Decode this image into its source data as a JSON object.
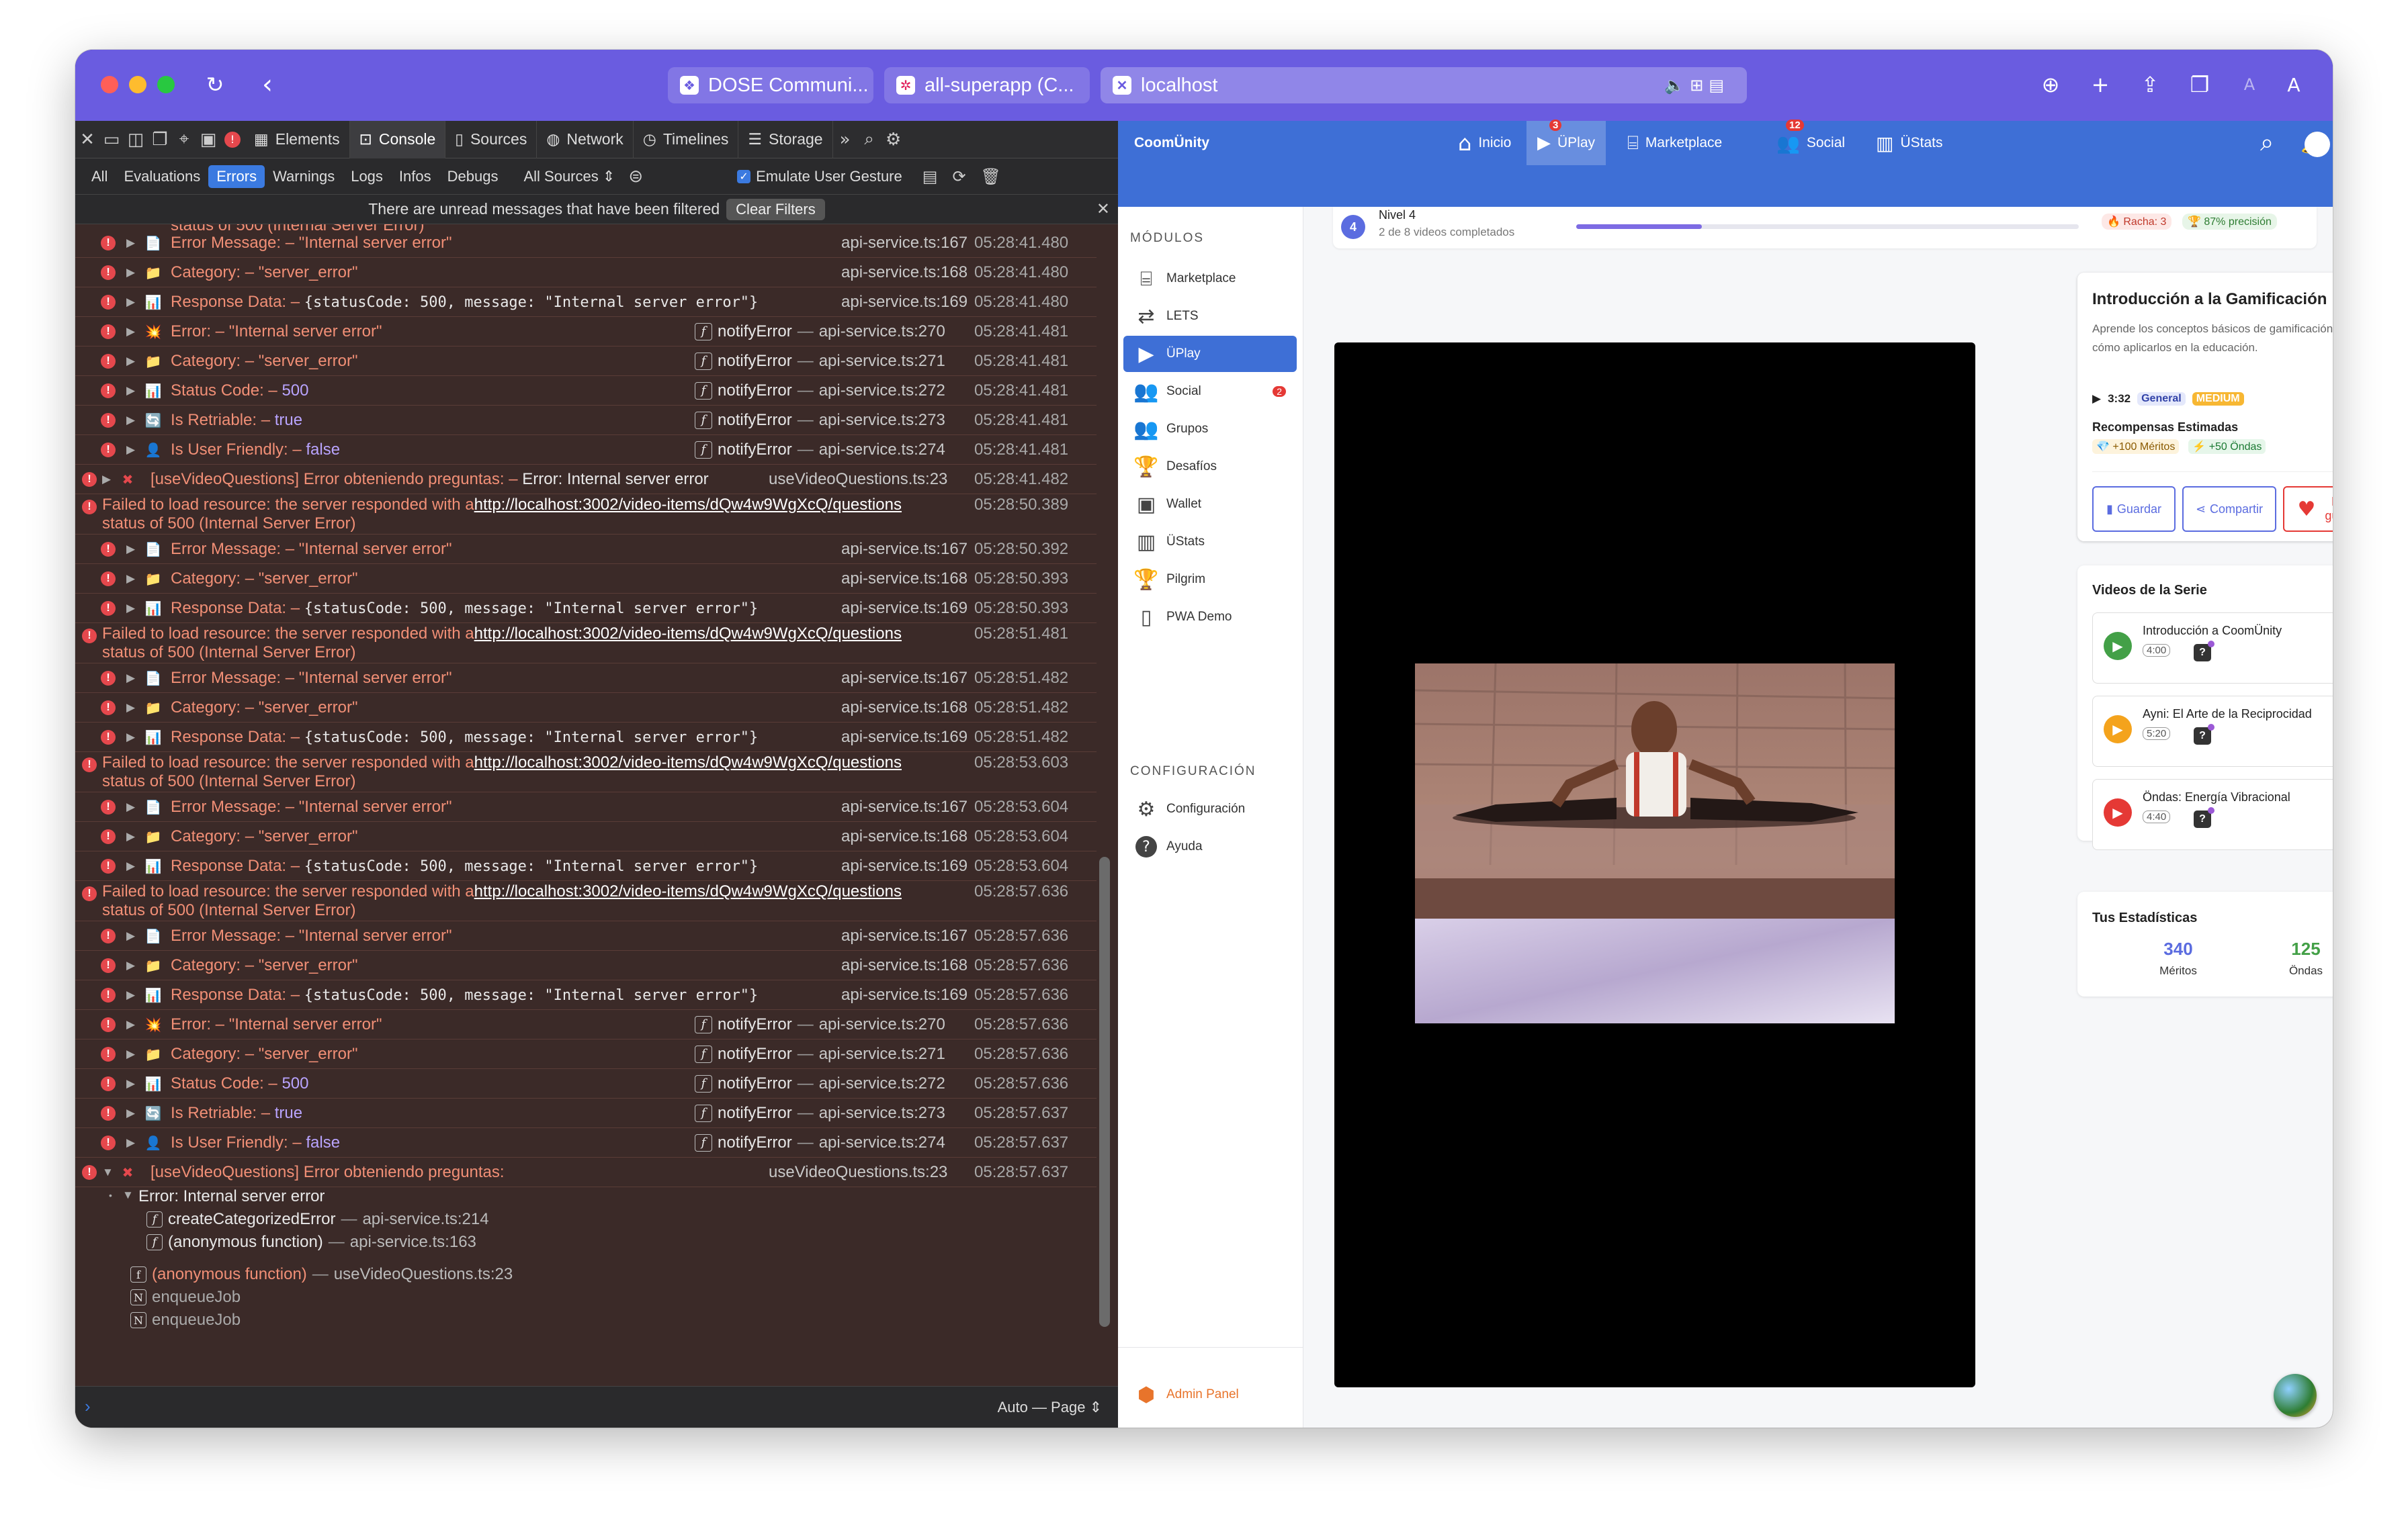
{
  "browser": {
    "tabs": [
      {
        "label": "DOSE Communi..."
      },
      {
        "label": "all-superapp (C..."
      },
      {
        "label": "localhost"
      }
    ],
    "profile_letters": [
      "A",
      "A"
    ]
  },
  "devtools": {
    "tabs": [
      "Elements",
      "Console",
      "Sources",
      "Network",
      "Timelines",
      "Storage"
    ],
    "filters": [
      "All",
      "Evaluations",
      "Errors",
      "Warnings",
      "Logs",
      "Infos",
      "Debugs",
      "All Sources"
    ],
    "emulate_label": "Emulate User Gesture",
    "banner": "There are unread messages that have been filtered",
    "clear_filters": "Clear Filters",
    "bottom_mode": "Auto — Page",
    "truncated_top": "status of 500 (Internal Server Error)",
    "rows": [
      {
        "type": "sub",
        "icon": "page",
        "label": "Error Message:",
        "value": "\"Internal server error\"",
        "src": "api-service.ts:167",
        "time": "05:28:41.480"
      },
      {
        "type": "sub",
        "icon": "folder",
        "label": "Category:",
        "value": "\"server_error\"",
        "src": "api-service.ts:168",
        "time": "05:28:41.480"
      },
      {
        "type": "resp",
        "icon": "chart",
        "label": "Response Data:",
        "value": "{statusCode: 500, message: \"Internal server error\"}",
        "src": "api-service.ts:169",
        "time": "05:28:41.480"
      },
      {
        "type": "fn",
        "icon": "boom",
        "label": "Error:",
        "value": "\"Internal server error\"",
        "fn": "notifyError",
        "src": "api-service.ts:270",
        "time": "05:28:41.481"
      },
      {
        "type": "fn",
        "icon": "folder",
        "label": "Category:",
        "value": "\"server_error\"",
        "fn": "notifyError",
        "src": "api-service.ts:271",
        "time": "05:28:41.481"
      },
      {
        "type": "fn",
        "icon": "chart",
        "label": "Status Code:",
        "value": "500",
        "fn": "notifyError",
        "src": "api-service.ts:272",
        "time": "05:28:41.481"
      },
      {
        "type": "fn",
        "icon": "retry",
        "label": "Is Retriable:",
        "value": "true",
        "fn": "notifyError",
        "src": "api-service.ts:273",
        "time": "05:28:41.481"
      },
      {
        "type": "fn",
        "icon": "user",
        "label": "Is User Friendly:",
        "value": "false",
        "fn": "notifyError",
        "src": "api-service.ts:274",
        "time": "05:28:41.481"
      },
      {
        "type": "top",
        "label": "[useVideoQuestions] Error obteniendo preguntas:",
        "value": "Error: Internal server error",
        "src": "useVideoQuestions.ts:23",
        "time": "05:28:41.482"
      },
      {
        "type": "fail",
        "text": "Failed to load resource: the server responded with a",
        "url": "http://localhost:3002/video-items/dQw4w9WgXcQ/questions",
        "line2": "status of 500 (Internal Server Error)",
        "time": "05:28:50.389"
      },
      {
        "type": "sub",
        "icon": "page",
        "label": "Error Message:",
        "value": "\"Internal server error\"",
        "src": "api-service.ts:167",
        "time": "05:28:50.392"
      },
      {
        "type": "sub",
        "icon": "folder",
        "label": "Category:",
        "value": "\"server_error\"",
        "src": "api-service.ts:168",
        "time": "05:28:50.393"
      },
      {
        "type": "resp",
        "icon": "chart",
        "label": "Response Data:",
        "value": "{statusCode: 500, message: \"Internal server error\"}",
        "src": "api-service.ts:169",
        "time": "05:28:50.393"
      },
      {
        "type": "fail",
        "text": "Failed to load resource: the server responded with a",
        "url": "http://localhost:3002/video-items/dQw4w9WgXcQ/questions",
        "line2": "status of 500 (Internal Server Error)",
        "time": "05:28:51.481"
      },
      {
        "type": "sub",
        "icon": "page",
        "label": "Error Message:",
        "value": "\"Internal server error\"",
        "src": "api-service.ts:167",
        "time": "05:28:51.482"
      },
      {
        "type": "sub",
        "icon": "folder",
        "label": "Category:",
        "value": "\"server_error\"",
        "src": "api-service.ts:168",
        "time": "05:28:51.482"
      },
      {
        "type": "resp",
        "icon": "chart",
        "label": "Response Data:",
        "value": "{statusCode: 500, message: \"Internal server error\"}",
        "src": "api-service.ts:169",
        "time": "05:28:51.482"
      },
      {
        "type": "fail",
        "text": "Failed to load resource: the server responded with a",
        "url": "http://localhost:3002/video-items/dQw4w9WgXcQ/questions",
        "line2": "status of 500 (Internal Server Error)",
        "time": "05:28:53.603"
      },
      {
        "type": "sub",
        "icon": "page",
        "label": "Error Message:",
        "value": "\"Internal server error\"",
        "src": "api-service.ts:167",
        "time": "05:28:53.604"
      },
      {
        "type": "sub",
        "icon": "folder",
        "label": "Category:",
        "value": "\"server_error\"",
        "src": "api-service.ts:168",
        "time": "05:28:53.604"
      },
      {
        "type": "resp",
        "icon": "chart",
        "label": "Response Data:",
        "value": "{statusCode: 500, message: \"Internal server error\"}",
        "src": "api-service.ts:169",
        "time": "05:28:53.604"
      },
      {
        "type": "fail",
        "text": "Failed to load resource: the server responded with a",
        "url": "http://localhost:3002/video-items/dQw4w9WgXcQ/questions",
        "line2": "status of 500 (Internal Server Error)",
        "time": "05:28:57.636"
      },
      {
        "type": "sub",
        "icon": "page",
        "label": "Error Message:",
        "value": "\"Internal server error\"",
        "src": "api-service.ts:167",
        "time": "05:28:57.636"
      },
      {
        "type": "sub",
        "icon": "folder",
        "label": "Category:",
        "value": "\"server_error\"",
        "src": "api-service.ts:168",
        "time": "05:28:57.636"
      },
      {
        "type": "resp",
        "icon": "chart",
        "label": "Response Data:",
        "value": "{statusCode: 500, message: \"Internal server error\"}",
        "src": "api-service.ts:169",
        "time": "05:28:57.636"
      },
      {
        "type": "fn",
        "icon": "boom",
        "label": "Error:",
        "value": "\"Internal server error\"",
        "fn": "notifyError",
        "src": "api-service.ts:270",
        "time": "05:28:57.636"
      },
      {
        "type": "fn",
        "icon": "folder",
        "label": "Category:",
        "value": "\"server_error\"",
        "fn": "notifyError",
        "src": "api-service.ts:271",
        "time": "05:28:57.636"
      },
      {
        "type": "fn",
        "icon": "chart",
        "label": "Status Code:",
        "value": "500",
        "fn": "notifyError",
        "src": "api-service.ts:272",
        "time": "05:28:57.636"
      },
      {
        "type": "fn",
        "icon": "retry",
        "label": "Is Retriable:",
        "value": "true",
        "fn": "notifyError",
        "src": "api-service.ts:273",
        "time": "05:28:57.637"
      },
      {
        "type": "fn",
        "icon": "user",
        "label": "Is User Friendly:",
        "value": "false",
        "fn": "notifyError",
        "src": "api-service.ts:274",
        "time": "05:28:57.637"
      },
      {
        "type": "topopen",
        "label": "[useVideoQuestions] Error obteniendo preguntas:",
        "src": "useVideoQuestions.ts:23",
        "time": "05:28:57.637"
      }
    ],
    "stack": {
      "error": "Error: Internal server error",
      "frames": [
        {
          "fn": "createCategorizedError",
          "loc": "api-service.ts:214"
        },
        {
          "fn": "(anonymous function)",
          "loc": "api-service.ts:163"
        }
      ],
      "outer": [
        {
          "fn": "(anonymous function)",
          "loc": "useVideoQuestions.ts:23",
          "kind": "f"
        },
        {
          "fn": "enqueueJob",
          "loc": "",
          "kind": "N"
        },
        {
          "fn": "enqueueJob",
          "loc": "",
          "kind": "N"
        }
      ]
    }
  },
  "app": {
    "brand": "CoomÜnity",
    "nav": [
      {
        "label": "Inicio",
        "icon": "home-icon"
      },
      {
        "label": "ÜPlay",
        "icon": "play-icon",
        "badge": "3"
      },
      {
        "label": "Marketplace",
        "icon": "store-icon"
      },
      {
        "label": "Social",
        "icon": "people-icon",
        "badge": "12"
      },
      {
        "label": "ÜStats",
        "icon": "stats-icon"
      }
    ],
    "sidebar": {
      "modules_heading": "MÓDULOS",
      "items": [
        {
          "label": "Marketplace",
          "icon": "store-icon"
        },
        {
          "label": "LETS",
          "icon": "swap-icon"
        },
        {
          "label": "ÜPlay",
          "icon": "play-icon"
        },
        {
          "label": "Social",
          "icon": "people-icon",
          "badge": "2"
        },
        {
          "label": "Grupos",
          "icon": "group-icon"
        },
        {
          "label": "Desafíos",
          "icon": "trophy-icon"
        },
        {
          "label": "Wallet",
          "icon": "wallet-icon"
        },
        {
          "label": "ÜStats",
          "icon": "stats-icon"
        },
        {
          "label": "Pilgrim",
          "icon": "trophy-icon"
        },
        {
          "label": "PWA Demo",
          "icon": "phone-icon"
        }
      ],
      "config_heading": "CONFIGURACIÓN",
      "config_items": [
        {
          "label": "Configuración",
          "icon": "gear-icon"
        },
        {
          "label": "Ayuda",
          "icon": "help-icon"
        }
      ],
      "admin": "Admin Panel"
    },
    "progress": {
      "level_number": "4",
      "level": "Nivel 4",
      "sub": "2 de 8 videos completados",
      "fraction": 0.25,
      "streak": "Racha: 3",
      "accuracy": "87% precisión"
    },
    "info": {
      "title": "Introducción a la Gamificación",
      "desc": "Aprende los conceptos básicos de gamificación y cómo aplicarlos en la educación.",
      "duration": "3:32",
      "chip1": "General",
      "chip2": "MEDIUM",
      "rewards_title": "Recompensas Estimadas",
      "reward1": "+100 Méritos",
      "reward2": "+50 Öndas",
      "btn_save": "Guardar",
      "btn_share": "Compartir",
      "btn_like": "Me gusta"
    },
    "series": {
      "title": "Videos de la Serie",
      "items": [
        {
          "title": "Introducción a CoomÜnity",
          "duration": "4:00",
          "color": "#43a047"
        },
        {
          "title": "Ayni: El Arte de la Reciprocidad",
          "duration": "5:20",
          "color": "#f4a31c"
        },
        {
          "title": "Öndas: Energía Vibracional",
          "duration": "4:40",
          "color": "#e53935"
        }
      ]
    },
    "stats": {
      "title": "Tus Estadísticas",
      "meritos_value": "340",
      "meritos_label": "Méritos",
      "ondas_value": "125",
      "ondas_label": "Öndas"
    }
  }
}
